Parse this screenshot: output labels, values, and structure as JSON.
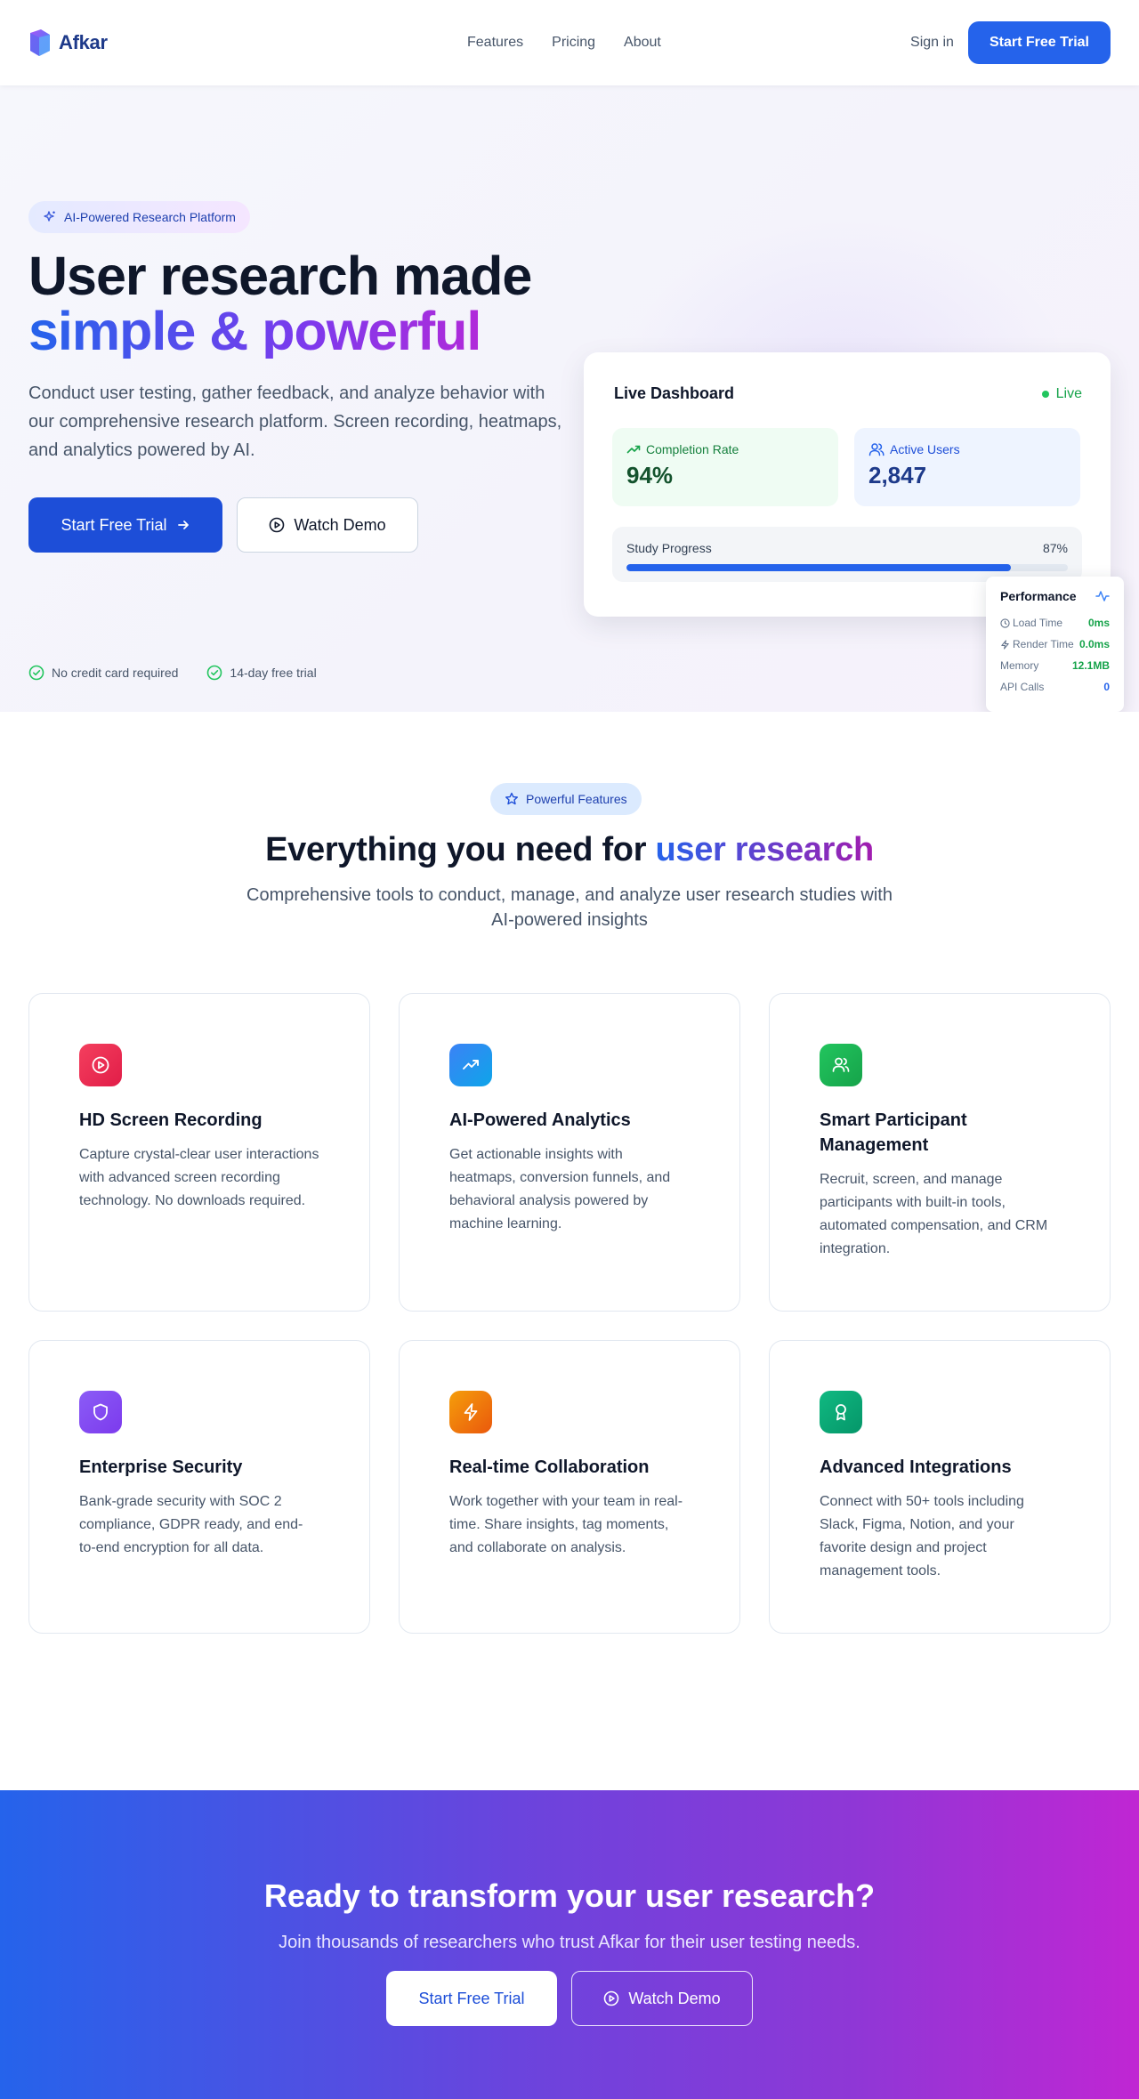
{
  "nav": {
    "brand": "Afkar",
    "links": [
      "Features",
      "Pricing",
      "About"
    ],
    "signin": "Sign in",
    "cta": "Start Free Trial"
  },
  "hero": {
    "badge": "AI-Powered Research Platform",
    "title_line1": "User research made",
    "title_line2": "simple & powerful",
    "description": "Conduct user testing, gather feedback, and analyze behavior with our comprehensive research platform. Screen recording, heatmaps, and analytics powered by AI.",
    "primary_cta": "Start Free Trial",
    "secondary_cta": "Watch Demo",
    "checks": [
      "No credit card required",
      "14-day free trial"
    ]
  },
  "dashboard": {
    "title": "Live Dashboard",
    "status": "Live",
    "stats": [
      {
        "label": "Completion Rate",
        "value": "94%"
      },
      {
        "label": "Active Users",
        "value": "2,847"
      }
    ],
    "progress": {
      "label": "Study Progress",
      "value_text": "87%",
      "fraction": 0.87
    }
  },
  "performance": {
    "title": "Performance",
    "rows": [
      {
        "label": "Load Time",
        "value": "0ms"
      },
      {
        "label": "Render Time",
        "value": "0.0ms"
      },
      {
        "label": "Memory",
        "value": "12.1MB"
      },
      {
        "label": "API Calls",
        "value": "0"
      }
    ]
  },
  "features": {
    "badge": "Powerful Features",
    "title_plain": "Everything you need for ",
    "title_highlight": "user research",
    "subtitle": "Comprehensive tools to conduct, manage, and analyze user research studies with AI-powered insights",
    "cards": [
      {
        "title": "HD Screen Recording",
        "description": "Capture crystal-clear user interactions with advanced screen recording technology. No downloads required.",
        "icon": "play-circle-icon",
        "color": "#e11d48"
      },
      {
        "title": "AI-Powered Analytics",
        "description": "Get actionable insights with heatmaps, conversion funnels, and behavioral analysis powered by machine learning.",
        "icon": "trending-up-icon",
        "color": "#2563eb"
      },
      {
        "title": "Smart Participant Management",
        "description": "Recruit, screen, and manage participants with built-in tools, automated compensation, and CRM integration.",
        "icon": "users-icon",
        "color": "#16a34a"
      },
      {
        "title": "Enterprise Security",
        "description": "Bank-grade security with SOC 2 compliance, GDPR ready, and end-to-end encryption for all data.",
        "icon": "shield-icon",
        "color": "#7c3aed"
      },
      {
        "title": "Real-time Collaboration",
        "description": "Work together with your team in real-time. Share insights, tag moments, and collaborate on analysis.",
        "icon": "lightning-icon",
        "color": "#f59e0b"
      },
      {
        "title": "Advanced Integrations",
        "description": "Connect with 50+ tools including Slack, Figma, Notion, and your favorite design and project management tools.",
        "icon": "award-icon",
        "color": "#10b981"
      }
    ]
  },
  "cta": {
    "title": "Ready to transform your user research?",
    "subtitle": "Join thousands of researchers who trust Afkar for their user testing needs.",
    "primary": "Start Free Trial",
    "secondary": "Watch Demo"
  }
}
